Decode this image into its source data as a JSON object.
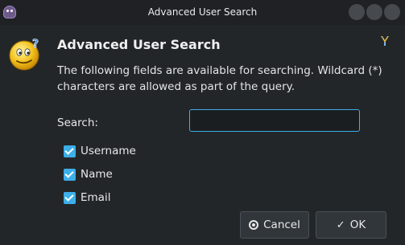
{
  "window": {
    "title": "Advanced User Search"
  },
  "icons": {
    "app": "app-icon",
    "dialog": "smiley-question-icon",
    "corner": "kleopatra-icon",
    "cancel": "cancel-icon",
    "ok": "checkmark-icon"
  },
  "dialog": {
    "heading": "Advanced User Search",
    "description": "The following fields are available for searching. Wildcard (*) characters are allowed as part of the query.",
    "search_label": "Search:",
    "search_value": "",
    "fields": [
      {
        "label": "Username",
        "checked": true
      },
      {
        "label": "Name",
        "checked": true
      },
      {
        "label": "Email",
        "checked": true
      }
    ]
  },
  "buttons": {
    "cancel": "Cancel",
    "ok": "OK"
  },
  "colors": {
    "accent": "#3daee9",
    "background": "#232629"
  }
}
